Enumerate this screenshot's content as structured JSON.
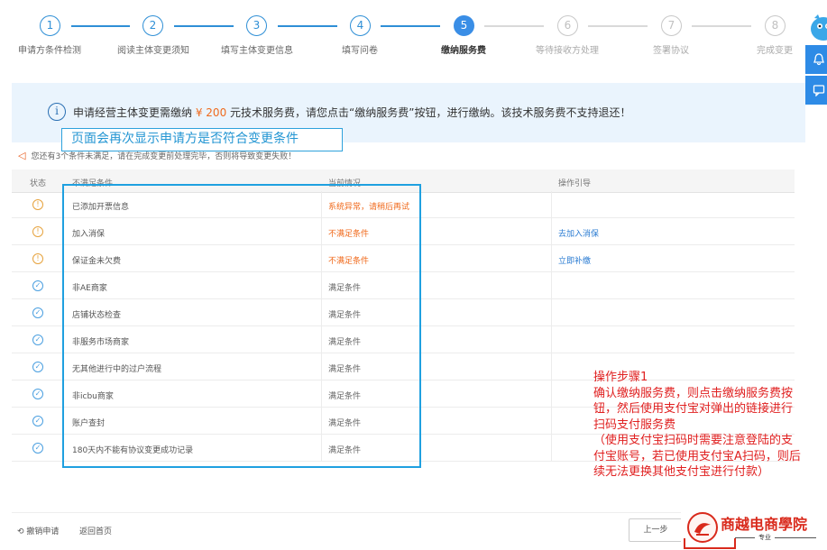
{
  "steps": [
    {
      "num": "1",
      "label": "申请方条件检测",
      "state": "done"
    },
    {
      "num": "2",
      "label": "阅读主体变更须知",
      "state": "done"
    },
    {
      "num": "3",
      "label": "填写主体变更信息",
      "state": "done"
    },
    {
      "num": "4",
      "label": "填写问卷",
      "state": "done"
    },
    {
      "num": "5",
      "label": "缴纳服务费",
      "state": "current"
    },
    {
      "num": "6",
      "label": "等待接收方处理",
      "state": "todo"
    },
    {
      "num": "7",
      "label": "签署协议",
      "state": "todo"
    },
    {
      "num": "8",
      "label": "完成变更",
      "state": "todo"
    }
  ],
  "notice": {
    "icon": "info-icon",
    "before": "申请经营主体变更需缴纳",
    "amount": "¥ 200",
    "after": "元技术服务费，请您点击“缴纳服务费”按钮，进行缴纳。该技术服务费不支持退还！"
  },
  "tip": "页面会再次显示申请方是否符合变更条件",
  "warning": "您还有3个条件未满足，请在完成变更前处理完毕，否则将导致变更失败！",
  "table": {
    "headers": {
      "status": "状态",
      "condition": "不满足条件",
      "current": "当前情况",
      "guide": "操作引导"
    },
    "rows": [
      {
        "status": "warning",
        "condition": "已添加开票信息",
        "current": "系统异常，请稍后再试",
        "guide": ""
      },
      {
        "status": "warning",
        "condition": "加入消保",
        "current": "不满足条件",
        "guide": "去加入消保"
      },
      {
        "status": "warning",
        "condition": "保证金未欠费",
        "current": "不满足条件",
        "guide": "立即补缴"
      },
      {
        "status": "ok",
        "condition": "非AE商家",
        "current": "满足条件",
        "guide": ""
      },
      {
        "status": "ok",
        "condition": "店铺状态检查",
        "current": "满足条件",
        "guide": ""
      },
      {
        "status": "ok",
        "condition": "非服务市场商家",
        "current": "满足条件",
        "guide": ""
      },
      {
        "status": "ok",
        "condition": "无其他进行中的过户流程",
        "current": "满足条件",
        "guide": ""
      },
      {
        "status": "ok",
        "condition": "非icbu商家",
        "current": "满足条件",
        "guide": ""
      },
      {
        "status": "ok",
        "condition": "账户查封",
        "current": "满足条件",
        "guide": ""
      },
      {
        "status": "ok",
        "condition": "180天内不能有协议变更成功记录",
        "current": "满足条件",
        "guide": ""
      }
    ]
  },
  "annotation": {
    "title": "操作步骤1",
    "line1": "确认缴纳服务费，则点击缴纳服务费按钮，然后使用支付宝对弹出的链接进行扫码支付服务费",
    "line2": "（使用支付宝扫码时需要注意登陆的支付宝账号，若已使用支付宝A扫码，则后续无法更换其他支付宝进行付款）"
  },
  "footer": {
    "revoke": "撤销申请",
    "home": "返回首页",
    "prev": "上一步"
  },
  "logo": {
    "name": "商越电商學院",
    "sub": "专业"
  },
  "colors": {
    "primary": "#3a8ee6",
    "warning": "#f06a1c",
    "annotation": "#e02020"
  }
}
